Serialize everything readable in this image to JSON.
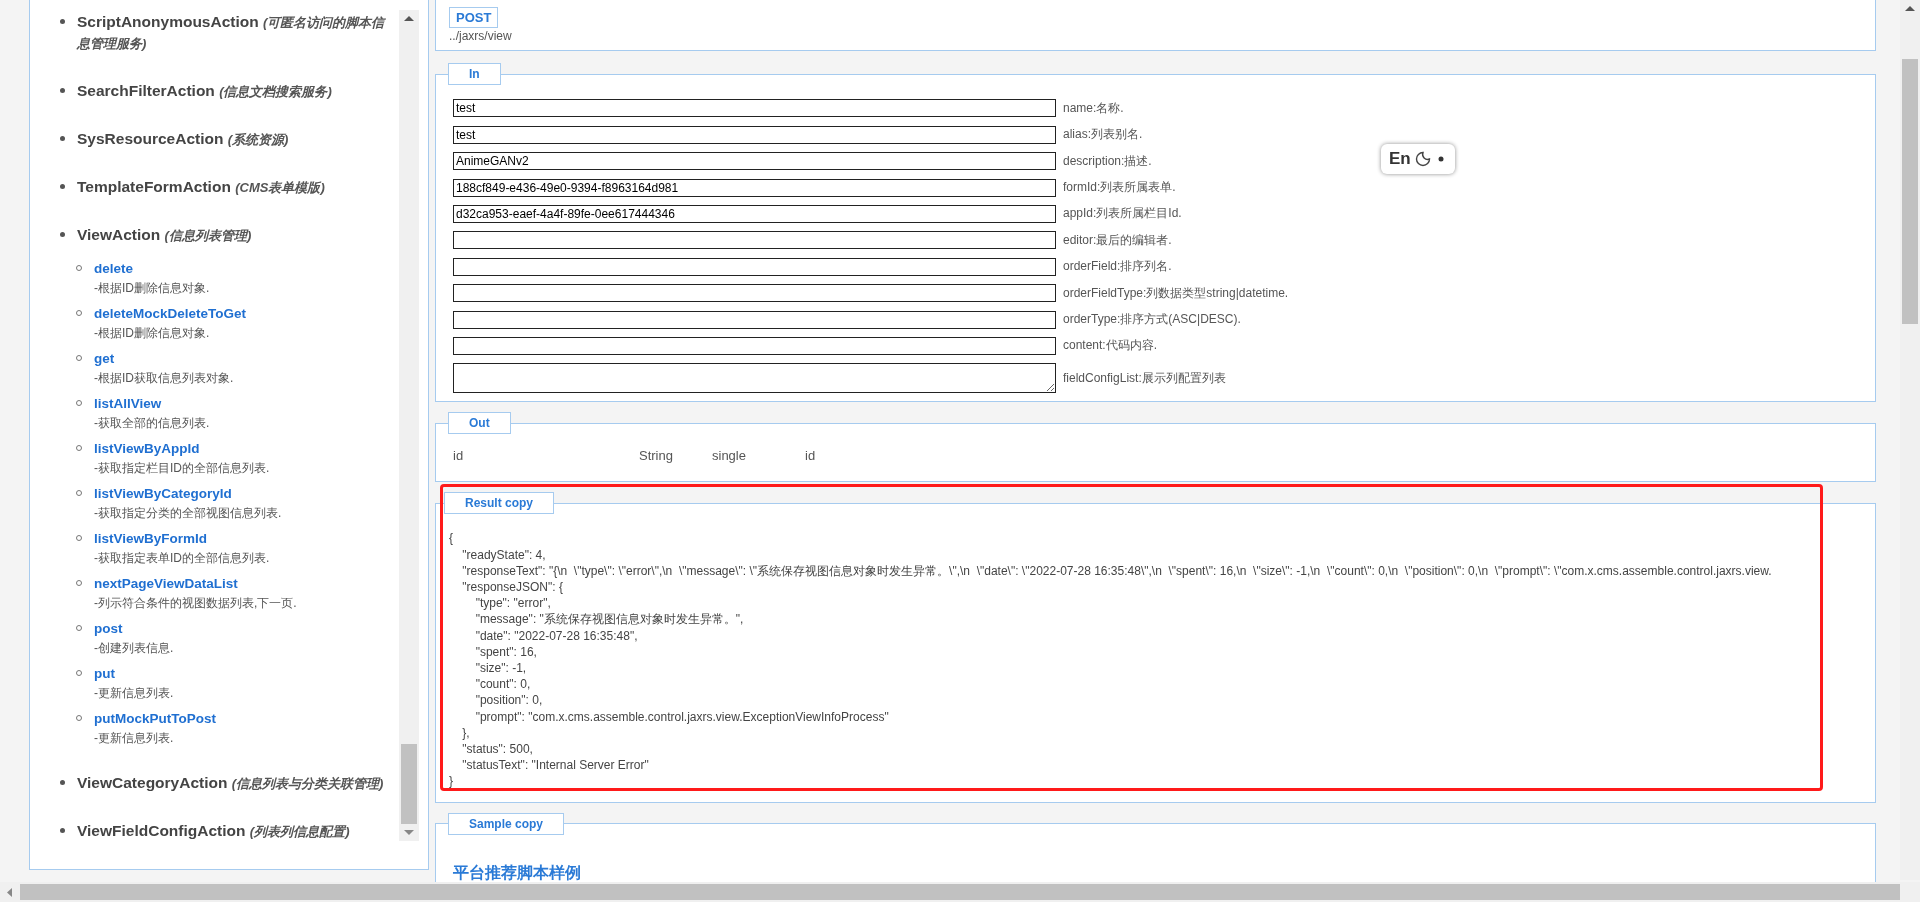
{
  "sidebar": {
    "groups": [
      {
        "name": "ScriptAnonymousAction",
        "description": "(可匿名访问的脚本信息管理服务)"
      },
      {
        "name": "SearchFilterAction",
        "description": "(信息文档搜索服务)"
      },
      {
        "name": "SysResourceAction",
        "description": "(系统资源)"
      },
      {
        "name": "TemplateFormAction",
        "description": "(CMS表单模版)"
      },
      {
        "name": "ViewAction",
        "description": "(信息列表管理)",
        "items": [
          {
            "name": "delete",
            "description": "-根据ID删除信息对象."
          },
          {
            "name": "deleteMockDeleteToGet",
            "description": "-根据ID删除信息对象."
          },
          {
            "name": "get",
            "description": "-根据ID获取信息列表对象."
          },
          {
            "name": "listAllView",
            "description": "-获取全部的信息列表."
          },
          {
            "name": "listViewByAppId",
            "description": "-获取指定栏目ID的全部信息列表."
          },
          {
            "name": "listViewByCategoryId",
            "description": "-获取指定分类的全部视图信息列表."
          },
          {
            "name": "listViewByFormId",
            "description": "-获取指定表单ID的全部信息列表."
          },
          {
            "name": "nextPageViewDataList",
            "description": "-列示符合条件的视图数据列表,下一页."
          },
          {
            "name": "post",
            "description": "-创建列表信息."
          },
          {
            "name": "put",
            "description": "-更新信息列表."
          },
          {
            "name": "putMockPutToPost",
            "description": "-更新信息列表."
          }
        ]
      },
      {
        "name": "ViewCategoryAction",
        "description": "(信息列表与分类关联管理)"
      },
      {
        "name": "ViewFieldConfigAction",
        "description": "(列表列信息配置)"
      }
    ]
  },
  "endpoint": {
    "method": "POST",
    "path": "../jaxrs/view"
  },
  "in_section": {
    "legend": "In",
    "fields": [
      {
        "kind": "input",
        "value": "test",
        "label": "name:名称."
      },
      {
        "kind": "input",
        "value": "test",
        "label": "alias:列表别名."
      },
      {
        "kind": "input",
        "value": "AnimeGANv2",
        "label": "description:描述."
      },
      {
        "kind": "input",
        "value": "188cf849-e436-49e0-9394-f8963164d981",
        "label": "formId:列表所属表单."
      },
      {
        "kind": "input",
        "value": "d32ca953-eaef-4a4f-89fe-0ee617444346",
        "label": "appId:列表所属栏目Id."
      },
      {
        "kind": "input",
        "label": "editor:最后的编辑者."
      },
      {
        "kind": "input",
        "label": "orderField:排序列名."
      },
      {
        "kind": "input",
        "label": "orderFieldType:列数据类型string|datetime."
      },
      {
        "kind": "input",
        "label": "orderType:排序方式(ASC|DESC)."
      },
      {
        "kind": "input",
        "label": "content:代码内容."
      },
      {
        "kind": "textarea",
        "label": "fieldConfigList:展示列配置列表"
      }
    ]
  },
  "out_section": {
    "legend": "Out",
    "columns": [
      "id",
      "String",
      "single",
      "id"
    ]
  },
  "result_section": {
    "legend": "Result copy",
    "lines": [
      "{",
      "    \"readyState\": 4,",
      "    \"responseText\": \"{\\n  \\\"type\\\": \\\"error\\\",\\n  \\\"message\\\": \\\"系统保存视图信息对象时发生异常。\\\",\\n  \\\"date\\\": \\\"2022-07-28 16:35:48\\\",\\n  \\\"spent\\\": 16,\\n  \\\"size\\\": -1,\\n  \\\"count\\\": 0,\\n  \\\"position\\\": 0,\\n  \\\"prompt\\\": \\\"com.x.cms.assemble.control.jaxrs.view.",
      "    \"responseJSON\": {",
      "        \"type\": \"error\",",
      "        \"message\": \"系统保存视图信息对象时发生异常。\",",
      "        \"date\": \"2022-07-28 16:35:48\",",
      "        \"spent\": 16,",
      "        \"size\": -1,",
      "        \"count\": 0,",
      "        \"position\": 0,",
      "        \"prompt\": \"com.x.cms.assemble.control.jaxrs.view.ExceptionViewInfoProcess\"",
      "    },",
      "    \"status\": 500,",
      "    \"statusText\": \"Internal Server Error\"",
      "}"
    ]
  },
  "sample_section": {
    "legend": "Sample copy",
    "heading": "平台推荐脚本样例"
  },
  "ime_indicator": {
    "label": "En"
  }
}
